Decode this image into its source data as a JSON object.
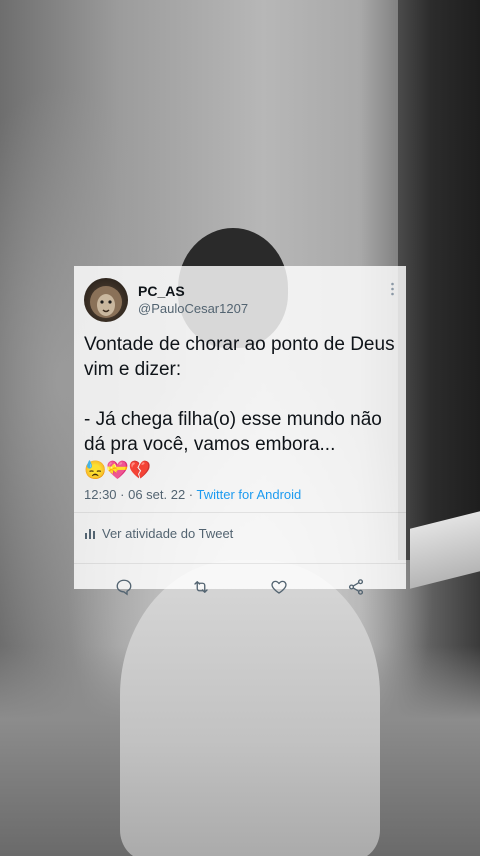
{
  "tweet": {
    "display_name": "PC_AS",
    "handle": "@PauloCesar1207",
    "text": "Vontade de chorar ao ponto de Deus vim e dizer:\n\n- Já chega filha(o) esse mundo não dá pra você, vamos embora...",
    "emojis": "😓💝💔",
    "timestamp": "12:30 · 06 set. 22 · ",
    "source": "Twitter for Android",
    "activity_label": "Ver atividade do Tweet"
  },
  "icons": {
    "more": "more-vertical-icon",
    "reply": "reply-icon",
    "retweet": "retweet-icon",
    "like": "heart-icon",
    "share": "share-icon",
    "activity": "bar-chart-icon"
  },
  "colors": {
    "accent": "#1d9bf0",
    "text": "#0f1419",
    "secondary": "#536471"
  }
}
